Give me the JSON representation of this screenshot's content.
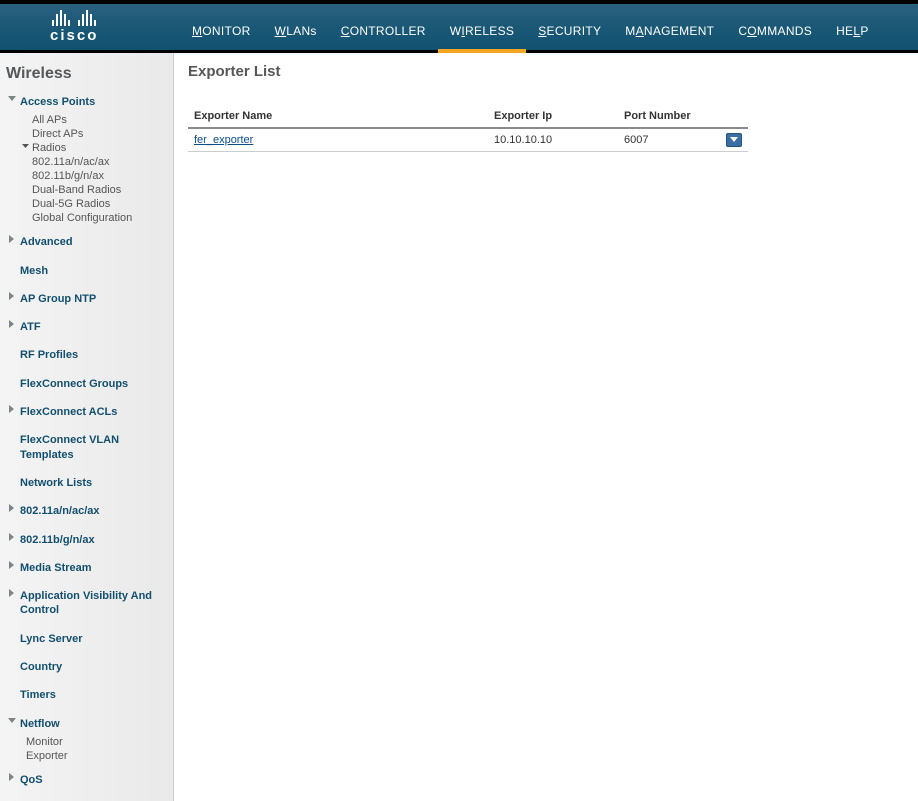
{
  "brand": "cisco",
  "nav": {
    "monitor": "MONITOR",
    "wlans": "WLANs",
    "controller": "CONTROLLER",
    "wireless": "WIRELESS",
    "security": "SECURITY",
    "management": "MANAGEMENT",
    "commands": "COMMANDS",
    "help": "HELP"
  },
  "sidebar": {
    "title": "Wireless",
    "access_points": {
      "label": "Access Points",
      "all_aps": "All APs",
      "direct_aps": "Direct APs",
      "radios": "Radios",
      "radio_a": "802.11a/n/ac/ax",
      "radio_b": "802.11b/g/n/ax",
      "dual_band": "Dual-Band Radios",
      "dual_5g": "Dual-5G Radios",
      "global_config": "Global Configuration"
    },
    "advanced": "Advanced",
    "mesh": "Mesh",
    "ap_group_ntp": "AP Group NTP",
    "atf": "ATF",
    "rf_profiles": "RF Profiles",
    "flexconnect_groups": "FlexConnect Groups",
    "flexconnect_acls": "FlexConnect ACLs",
    "flexconnect_vlan": "FlexConnect VLAN Templates",
    "network_lists": "Network Lists",
    "band_a": "802.11a/n/ac/ax",
    "band_b": "802.11b/g/n/ax",
    "media_stream": "Media Stream",
    "avc": "Application Visibility And Control",
    "lync": "Lync Server",
    "country": "Country",
    "timers": "Timers",
    "netflow": {
      "label": "Netflow",
      "monitor": "Monitor",
      "exporter": "Exporter"
    },
    "qos": "QoS"
  },
  "page": {
    "title": "Exporter List",
    "cols": {
      "name": "Exporter Name",
      "ip": "Exporter Ip",
      "port": "Port Number"
    },
    "rows": [
      {
        "name": "fer_exporter",
        "ip": "10.10.10.10",
        "port": "6007"
      }
    ]
  }
}
